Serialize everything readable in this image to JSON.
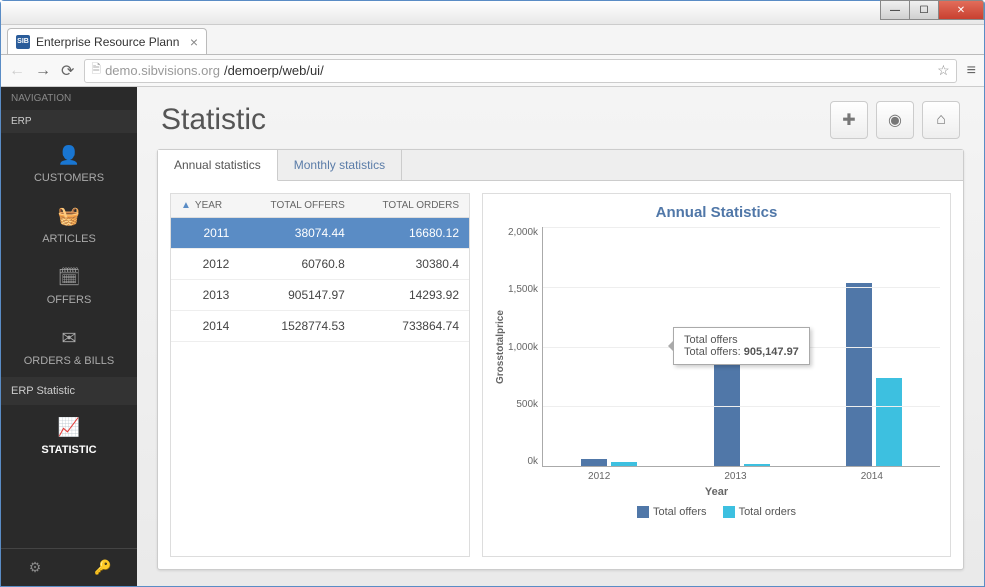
{
  "window": {
    "tab_title": "Enterprise Resource Plann",
    "favicon_text": "SIB",
    "url_host": "demo.sibvisions.org",
    "url_path": "/demoerp/web/ui/"
  },
  "sidebar": {
    "nav_label": "NAVIGATION",
    "erp_label": "ERP",
    "items": [
      {
        "label": "CUSTOMERS",
        "icon": "👤"
      },
      {
        "label": "ARTICLES",
        "icon": "🧺"
      },
      {
        "label": "OFFERS",
        "icon": "🗓"
      },
      {
        "label": "ORDERS & BILLS",
        "icon": "✉"
      }
    ],
    "sub_label": "ERP Statistic",
    "statistic_label": "STATISTIC",
    "statistic_icon": "📈"
  },
  "page": {
    "title": "Statistic"
  },
  "tabs": {
    "annual": "Annual statistics",
    "monthly": "Monthly statistics"
  },
  "table": {
    "headers": {
      "year": "YEAR",
      "offers": "TOTAL OFFERS",
      "orders": "TOTAL ORDERS"
    },
    "rows": [
      {
        "year": "2011",
        "offers": "38074.44",
        "orders": "16680.12",
        "selected": true
      },
      {
        "year": "2012",
        "offers": "60760.8",
        "orders": "30380.4"
      },
      {
        "year": "2013",
        "offers": "905147.97",
        "orders": "14293.92"
      },
      {
        "year": "2014",
        "offers": "1528774.53",
        "orders": "733864.74"
      }
    ]
  },
  "chart": {
    "title": "Annual Statistics",
    "ylabel": "Grosstotalprice",
    "xlabel": "Year",
    "legend": {
      "offers": "Total offers",
      "orders": "Total orders"
    },
    "tooltip": {
      "line1": "Total offers",
      "line2_label": "Total offers: ",
      "line2_value": "905,147.97"
    }
  },
  "chart_data": {
    "type": "bar",
    "title": "Annual Statistics",
    "xlabel": "Year",
    "ylabel": "Grosstotalprice",
    "ylim": [
      0,
      2000000
    ],
    "yticks": [
      "2,000k",
      "1,500k",
      "1,000k",
      "500k",
      "0k"
    ],
    "categories": [
      "2012",
      "2013",
      "2014"
    ],
    "series": [
      {
        "name": "Total offers",
        "color": "#5077a8",
        "values": [
          60760.8,
          905147.97,
          1528774.53
        ]
      },
      {
        "name": "Total orders",
        "color": "#3dc0e0",
        "values": [
          30380.4,
          14293.92,
          733864.74
        ]
      }
    ]
  }
}
